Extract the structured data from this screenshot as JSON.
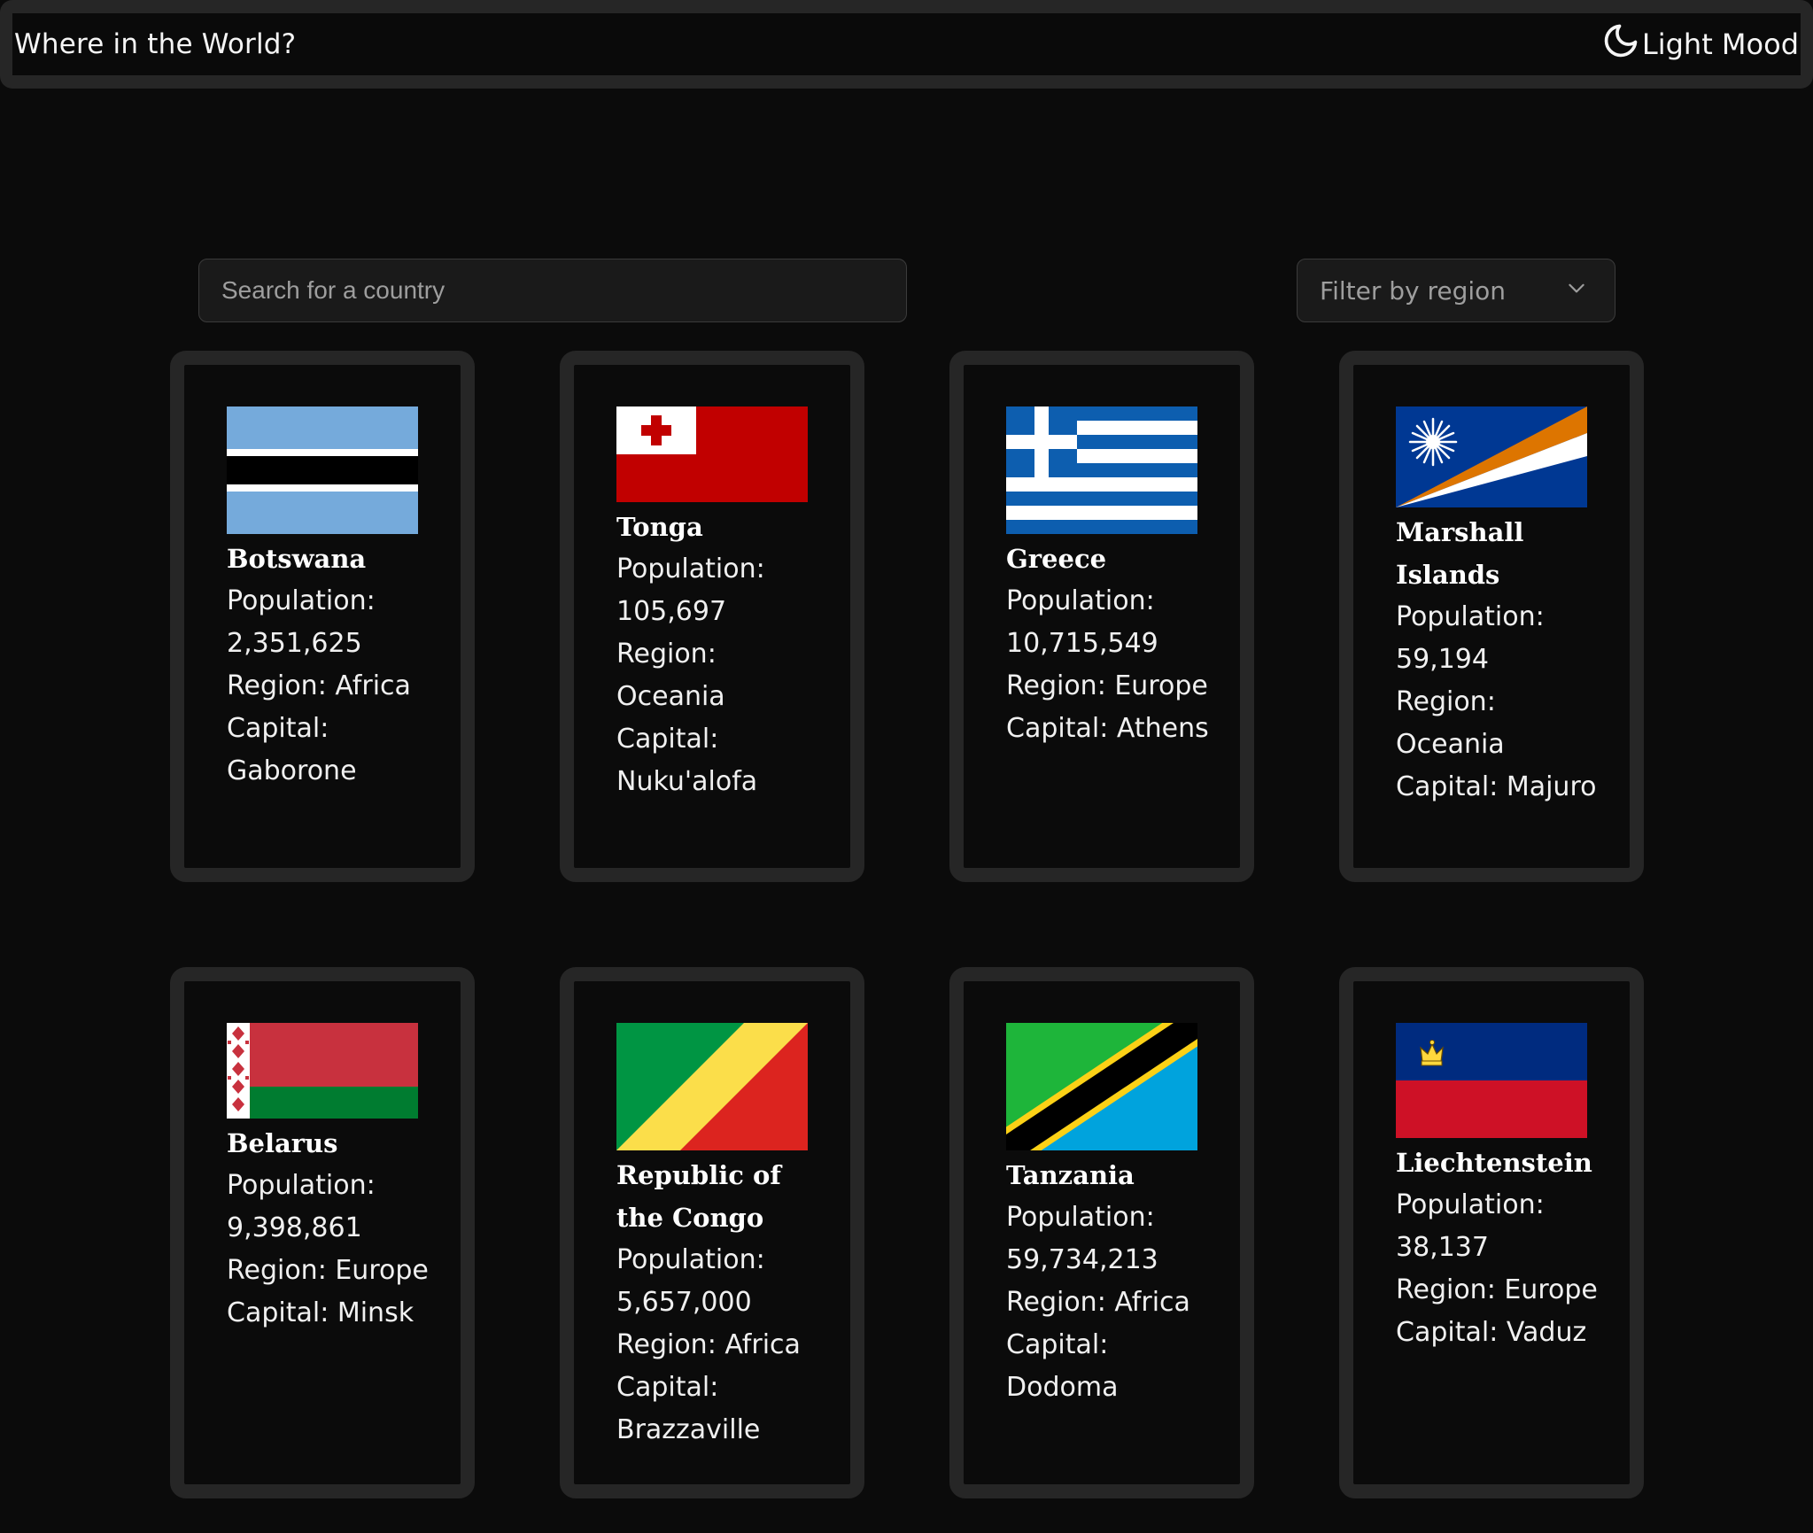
{
  "header": {
    "title": "Where in the World?",
    "theme_label": "Light Mood",
    "theme_icon": "moon-icon"
  },
  "search": {
    "placeholder": "Search for a country"
  },
  "filter": {
    "label": "Filter by region",
    "icon": "chevron-down-icon"
  },
  "countries": [
    {
      "name": "Botswana",
      "population_label": "Population:",
      "population": "2,351,625",
      "region_line": "Region: Africa",
      "capital_label": "Capital:",
      "capital": "Gaborone"
    },
    {
      "name": "Tonga",
      "population_label": "Population:",
      "population": "105,697",
      "region_label": "Region:",
      "region": "Oceania",
      "capital_label": "Capital:",
      "capital": "Nuku'alofa"
    },
    {
      "name": "Greece",
      "population_label": "Population:",
      "population": "10,715,549",
      "region_line": "Region: Europe",
      "capital_line": "Capital: Athens"
    },
    {
      "name_line1": "Marshall",
      "name_line2": "Islands",
      "population_label": "Population:",
      "population": "59,194",
      "region_label": "Region:",
      "region": "Oceania",
      "capital_line": "Capital: Majuro"
    },
    {
      "name": "Belarus",
      "population_label": "Population:",
      "population": "9,398,861",
      "region_line": "Region: Europe",
      "capital_line": "Capital: Minsk"
    },
    {
      "name_line1": "Republic of",
      "name_line2": "the Congo",
      "population_label": "Population:",
      "population": "5,657,000",
      "region_line": "Region: Africa",
      "capital_label": "Capital:",
      "capital": "Brazzaville"
    },
    {
      "name": "Tanzania",
      "population_label": "Population:",
      "population": "59,734,213",
      "region_line": "Region: Africa",
      "capital_label": "Capital:",
      "capital": "Dodoma"
    },
    {
      "name": "Liechtenstein",
      "population_label": "Population:",
      "population": "38,137",
      "region_line": "Region: Europe",
      "capital_line": "Capital: Vaduz"
    }
  ]
}
